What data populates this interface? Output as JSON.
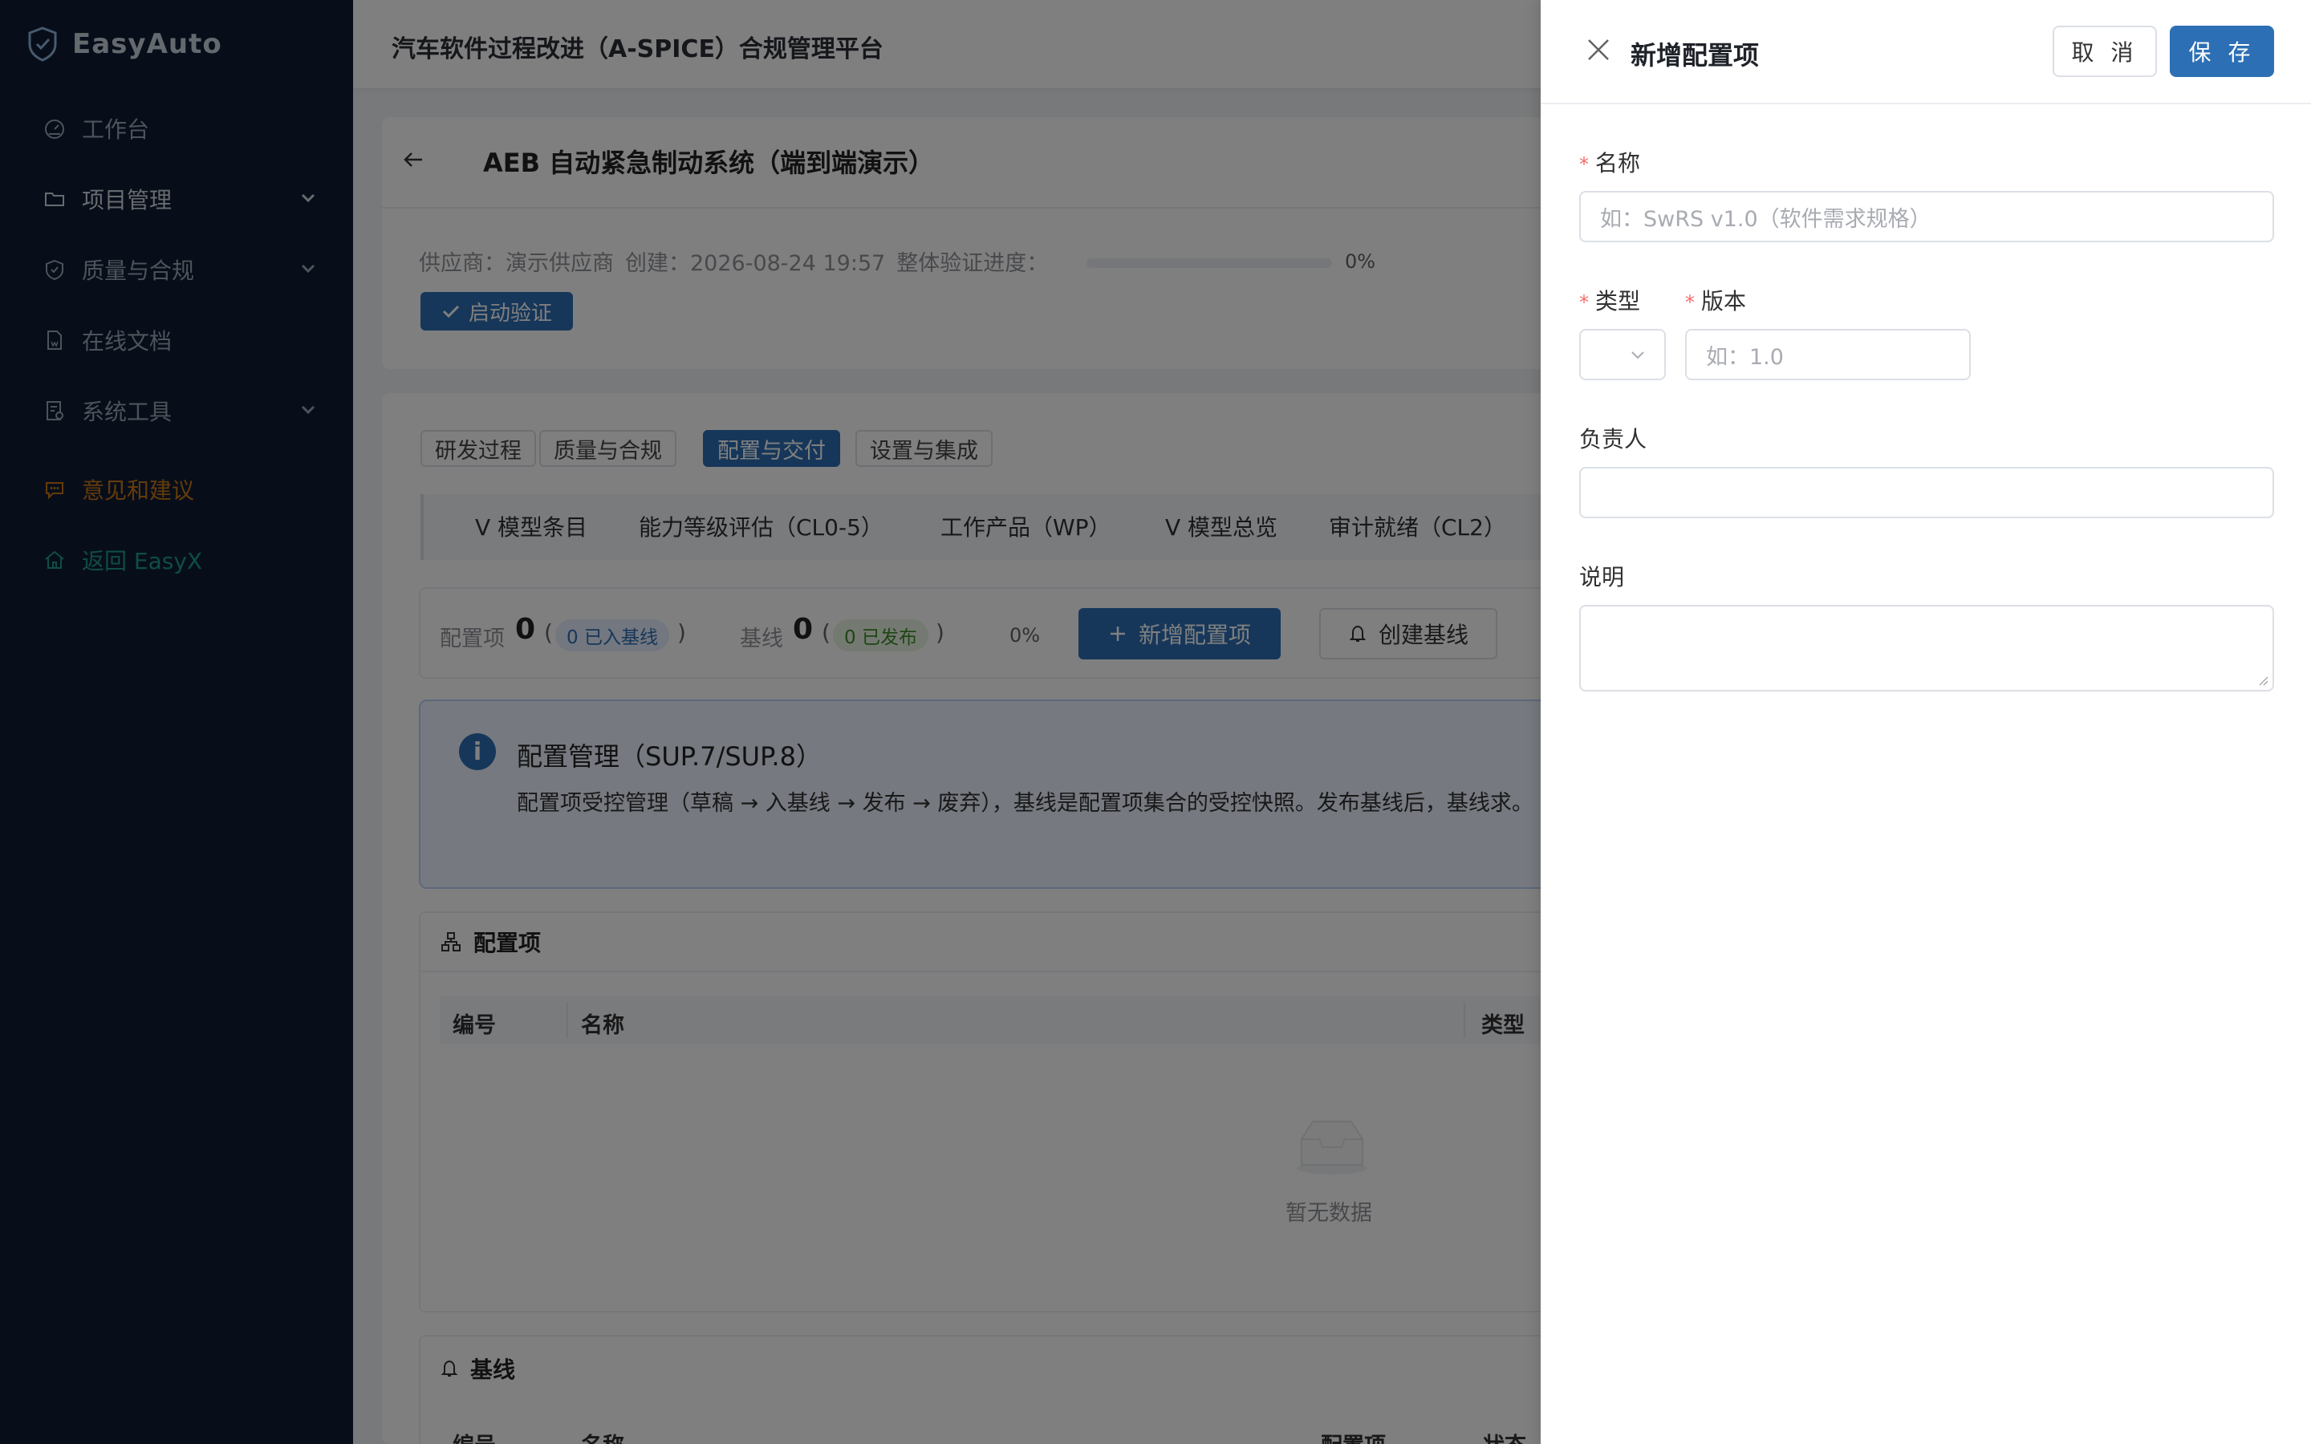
{
  "sidebar": {
    "brand": "EasyAuto",
    "items": [
      {
        "label": "工作台"
      },
      {
        "label": "项目管理"
      },
      {
        "label": "质量与合规"
      },
      {
        "label": "在线文档"
      },
      {
        "label": "系统工具"
      },
      {
        "label": "意见和建议"
      },
      {
        "label": "返回 EasyX"
      }
    ]
  },
  "header": {
    "title": "汽车软件过程改进（A-SPICE）合规管理平台"
  },
  "project": {
    "title": "AEB 自动紧急制动系统（端到端演示）",
    "supplier": "供应商：演示供应商",
    "created": "创建：2026-08-24 19:57",
    "progress_label": "整体验证进度：",
    "progress_value": 0,
    "progress_text": "0%",
    "start_button": "启动验证"
  },
  "tabs": [
    {
      "label": "研发过程"
    },
    {
      "label": "质量与合规"
    },
    {
      "label": "配置与交付"
    },
    {
      "label": "设置与集成"
    }
  ],
  "subtabs": [
    {
      "label": "V 模型条目"
    },
    {
      "label": "能力等级评估（CL0-5）"
    },
    {
      "label": "工作产品（WP）"
    },
    {
      "label": "V 模型总览"
    },
    {
      "label": "审计就绪（CL2）"
    }
  ],
  "summary": {
    "items_label": "配置项",
    "items_count": "0",
    "items_tag": "0 已入基线",
    "baseline_label": "基线",
    "baseline_count": "0",
    "baseline_tag": "0 已发布",
    "percent": "0%",
    "paren_open": "(",
    "paren_close": ")",
    "add_button": "新增配置项",
    "baseline_button": "创建基线"
  },
  "alert": {
    "title": "配置管理（SUP.7/SUP.8）",
    "text": "配置项受控管理（草稿 → 入基线 → 发布 → 废弃），基线是配置项集合的受控快照。发布基线后，基线求。"
  },
  "config_panel": {
    "title": "配置项",
    "columns": [
      "编号",
      "名称",
      "类型"
    ],
    "empty": "暂无数据"
  },
  "baseline_panel": {
    "title": "基线",
    "columns": [
      "编号",
      "名称",
      "配置项",
      "状态"
    ]
  },
  "drawer": {
    "title": "新增配置项",
    "cancel": "取 消",
    "save": "保 存",
    "name_label": "名称",
    "name_placeholder": "如：SwRS v1.0（软件需求规格）",
    "type_label": "类型",
    "version_label": "版本",
    "version_placeholder": "如：1.0",
    "owner_label": "负责人",
    "desc_label": "说明",
    "required_mark": "*"
  },
  "colors": {
    "sidebar_bg": "#0f1c33",
    "primary": "#2c6fb4",
    "feedback": "#c97716",
    "back": "#1e9a8a",
    "required": "#f56c6c"
  }
}
